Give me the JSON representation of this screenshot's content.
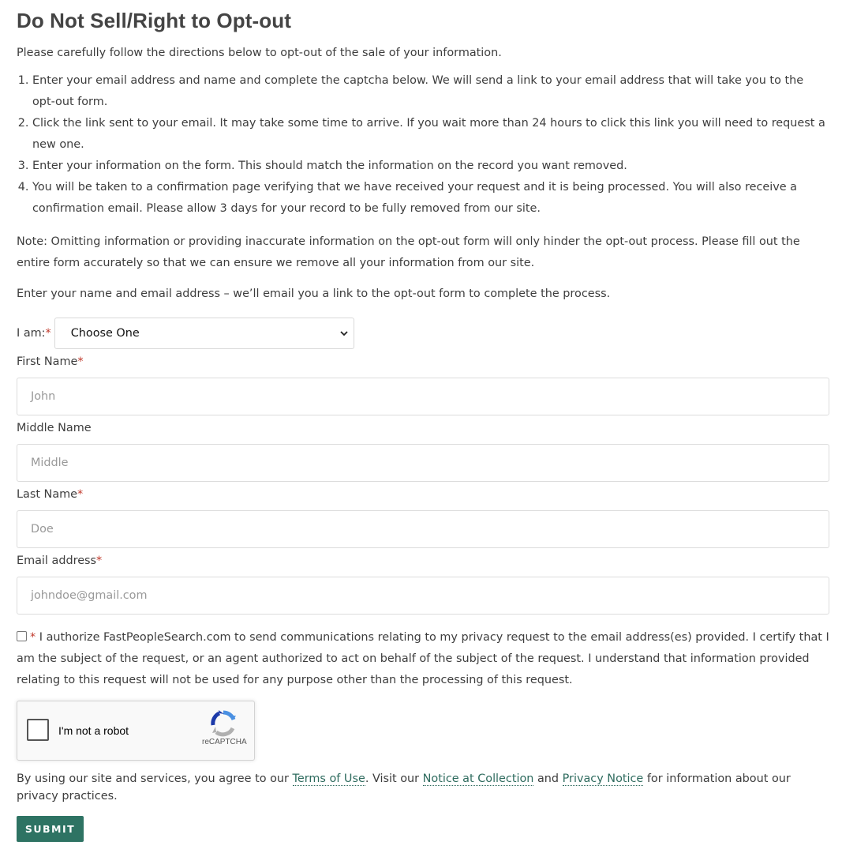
{
  "title": "Do Not Sell/Right to Opt-out",
  "intro": "Please carefully follow the directions below to opt-out of the sale of your information.",
  "steps": [
    "Enter your email address and name and complete the captcha below. We will send a link to your email address that will take you to the opt-out form.",
    "Click the link sent to your email. It may take some time to arrive. If you wait more than 24 hours to click this link you will need to request a new one.",
    "Enter your information on the form. This should match the information on the record you want removed.",
    "You will be taken to a confirmation page verifying that we have received your request and it is being processed. You will also receive a confirmation email. Please allow 3 days for your record to be fully removed from our site."
  ],
  "note": "Note: Omitting information or providing inaccurate information on the opt-out form will only hinder the opt-out process. Please fill out the entire form accurately so that we can ensure we remove all your information from our site.",
  "enter_text": "Enter your name and email address – we’ll email you a link to the opt-out form to complete the process.",
  "required_mark": "*",
  "iam": {
    "label": "I am:",
    "selected": "Choose One"
  },
  "fields": {
    "first_name": {
      "label": "First Name",
      "placeholder": "John"
    },
    "middle_name": {
      "label": "Middle Name",
      "placeholder": "Middle"
    },
    "last_name": {
      "label": "Last Name",
      "placeholder": "Doe"
    },
    "email": {
      "label": "Email address",
      "placeholder": "johndoe@gmail.com"
    }
  },
  "consent": "I authorize FastPeopleSearch.com to send communications relating to my privacy request to the email address(es) provided. I certify that I am the subject of the request, or an agent authorized to act on behalf of the subject of the request. I understand that information provided relating to this request will not be used for any purpose other than the processing of this request.",
  "captcha": {
    "label": "I'm not a robot",
    "brand": "reCAPTCHA"
  },
  "legal": {
    "prefix": "By using our site and services, you agree to our ",
    "terms": "Terms of Use",
    "mid1": ". Visit our ",
    "notice_collection": "Notice at Collection",
    "mid2": " and ",
    "privacy": "Privacy Notice",
    "suffix": " for information about our privacy practices."
  },
  "submit_label": "SUBMIT",
  "colors": {
    "accent": "#2e7363",
    "link": "#2e6b5e",
    "required": "#c0392b"
  }
}
